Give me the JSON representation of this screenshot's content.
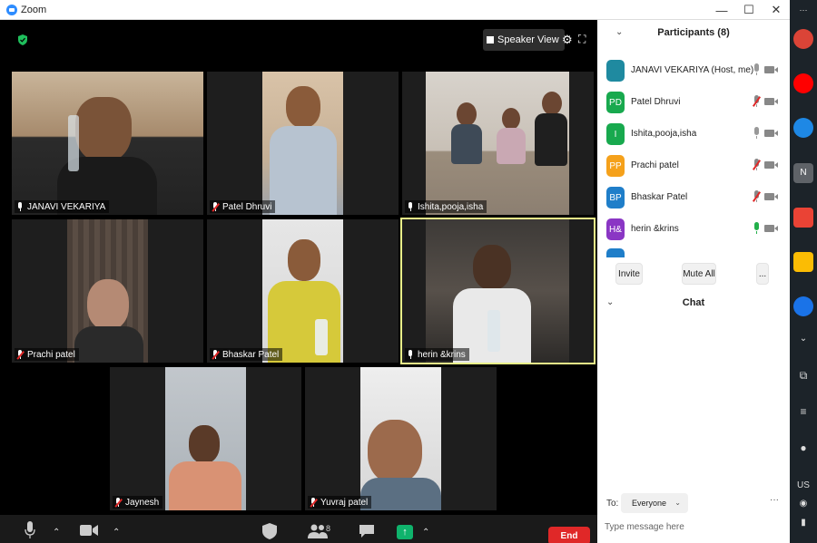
{
  "window": {
    "title": "Zoom",
    "minimize": "—",
    "maximize": "☐",
    "close": "✕"
  },
  "video": {
    "view_button": "Speaker View",
    "tiles": [
      {
        "name": "JANAVI VEKARIYA",
        "muted": false
      },
      {
        "name": "Patel Dhruvi",
        "muted": true
      },
      {
        "name": "Ishita,pooja,isha",
        "muted": false
      },
      {
        "name": "Prachi patel",
        "muted": true
      },
      {
        "name": "Bhaskar Patel",
        "muted": true
      },
      {
        "name": "herin &krins",
        "muted": false,
        "active": true
      },
      {
        "name": "Jaynesh",
        "muted": true
      },
      {
        "name": "Yuvraj patel",
        "muted": true
      }
    ]
  },
  "toolbar": {
    "participants_count": "8",
    "end_label": "End"
  },
  "participants": {
    "title": "Participants (8)",
    "items": [
      {
        "initials": "",
        "name": "JANAVI VEKARIYA (Host, me)",
        "color": "#1f8aa0",
        "mic": "on"
      },
      {
        "initials": "PD",
        "name": "Patel Dhruvi",
        "color": "#18a94e",
        "mic": "muted"
      },
      {
        "initials": "I",
        "name": "Ishita,pooja,isha",
        "color": "#18a94e",
        "mic": "on"
      },
      {
        "initials": "PP",
        "name": "Prachi patel",
        "color": "#f5a11b",
        "mic": "muted"
      },
      {
        "initials": "BP",
        "name": "Bhaskar Patel",
        "color": "#1f7ec9",
        "mic": "muted"
      },
      {
        "initials": "H&",
        "name": "herin &krins",
        "color": "#8a36c4",
        "mic": "talking"
      }
    ],
    "invite_label": "Invite",
    "mute_all_label": "Mute All",
    "more_label": "..."
  },
  "chat": {
    "title": "Chat",
    "to_label": "To:",
    "recipient": "Everyone",
    "more_label": "···",
    "placeholder": "Type message here"
  },
  "taskbar": {
    "app_colors": [
      "#db4437",
      "#ff0000",
      "#1e88e5",
      "#5f6368",
      "#ea4335",
      "#fbbc04",
      "#1a73e8"
    ],
    "app_initial": "N",
    "lang": "US"
  }
}
